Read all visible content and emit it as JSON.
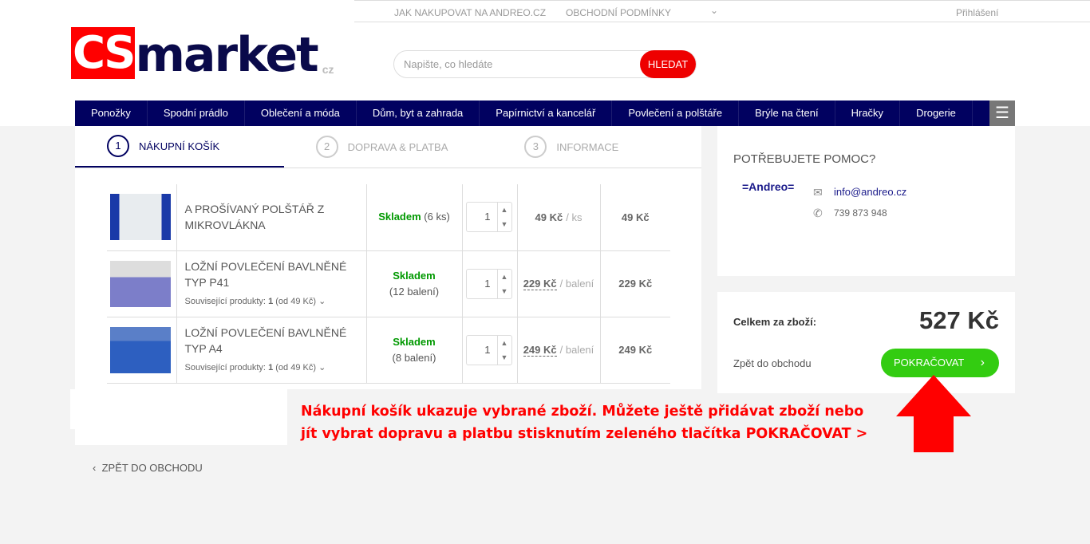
{
  "top": {
    "links": [
      "JAK NAKUPOVAT NA ANDREO.CZ",
      "OBCHODNÍ PODMÍNKY"
    ],
    "login": "Přihlášení"
  },
  "logo": {
    "cs": "CS",
    "market": "market",
    "cz": "cz"
  },
  "search": {
    "placeholder": "Napište, co hledáte",
    "button": "HLEDAT"
  },
  "nav": [
    "Ponožky",
    "Spodní prádlo",
    "Oblečení a móda",
    "Dům, byt a zahrada",
    "Papírnictví a kancelář",
    "Povlečení a polštáře",
    "Brýle na čtení",
    "Hračky",
    "Drogerie"
  ],
  "steps": [
    {
      "n": "1",
      "label": "NÁKUPNÍ KOŠÍK"
    },
    {
      "n": "2",
      "label": "DOPRAVA & PLATBA"
    },
    {
      "n": "3",
      "label": "INFORMACE"
    }
  ],
  "items": [
    {
      "name": "A PROŠÍVANÝ POLŠTÁŘ Z MIKROVLÁKNA",
      "stock": "Skladem",
      "stock_qty": "(6 ks)",
      "qty": "1",
      "price": "49 Kč",
      "unit": "/ ks",
      "total": "49 Kč"
    },
    {
      "name": "LOŽNÍ POVLEČENÍ BAVLNĚNÉ TYP P41",
      "stock": "Skladem",
      "stock_qty": "(12 balení)",
      "qty": "1",
      "price": "229 Kč",
      "unit": "/ balení",
      "total": "229 Kč",
      "rel_label": "Související produkty:",
      "rel_count": "1",
      "rel_from": "(od 49 Kč)"
    },
    {
      "name": "LOŽNÍ POVLEČENÍ BAVLNĚNÉ TYP A4",
      "stock": "Skladem",
      "stock_qty": "(8 balení)",
      "qty": "1",
      "price": "249 Kč",
      "unit": "/ balení",
      "total": "249 Kč",
      "rel_label": "Související produkty:",
      "rel_count": "1",
      "rel_from": "(od 49 Kč)"
    }
  ],
  "help": {
    "title": "POTŘEBUJETE POMOC?",
    "brand": "=Andreo=",
    "email": "info@andreo.cz",
    "phone": "739 873 948"
  },
  "summary": {
    "label": "Celkem za zboží:",
    "total": "527 Kč",
    "back": "Zpět do obchodu",
    "continue": "POKRAČOVAT"
  },
  "back_link": "ZPĚT DO OBCHODU",
  "note": "Nákupní košík ukazuje vybrané zboží. Můžete ještě přidávat zboží nebo jít vybrat dopravu a platbu stisknutím zeleného tlačítka POKRAČOVAT >"
}
